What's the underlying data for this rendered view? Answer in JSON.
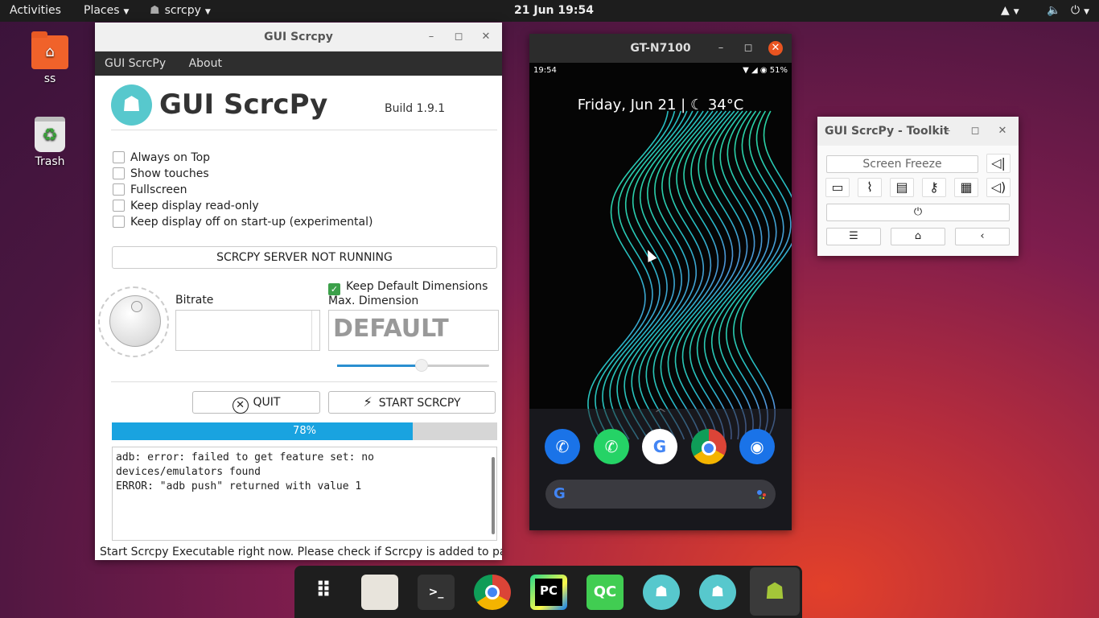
{
  "topbar": {
    "activities": "Activities",
    "places": "Places",
    "app_menu": "scrcpy",
    "clock": "21 Jun  19:54"
  },
  "desktop": {
    "home_label": "ss",
    "trash_label": "Trash"
  },
  "main_window": {
    "title": "GUI Scrcpy",
    "menu": [
      "GUI ScrcPy",
      "About"
    ],
    "app_name": "GUI ScrcPy",
    "build": "Build 1.9.1",
    "options": [
      {
        "label": "Always on Top",
        "checked": false
      },
      {
        "label": "Show touches",
        "checked": false
      },
      {
        "label": "Fullscreen",
        "checked": false
      },
      {
        "label": "Keep display read-only",
        "checked": false
      },
      {
        "label": "Keep display off on start-up (experimental)",
        "checked": false
      }
    ],
    "server_status": "SCRCPY SERVER NOT RUNNING",
    "keep_default_dimensions": {
      "label": "Keep Default Dimensions",
      "checked": true
    },
    "bitrate_label": "Bitrate",
    "max_dimension_label": "Max. Dimension",
    "max_dimension_value": "DEFAULT",
    "slider_level": 0.55,
    "quit_label": "QUIT",
    "start_label": "START SCRCPY",
    "progress": 78,
    "progress_text": "78%",
    "log": "adb: error: failed to get feature set: no\ndevices/emulators found\nERROR: \"adb push\" returned with value 1",
    "status_bar": "Start Scrcpy Executable right now. Please check if Scrcpy is added to path"
  },
  "phone_window": {
    "title": "GT-N7100",
    "status_time": "19:54",
    "battery": "51%",
    "date_widget": "Friday, Jun 21  |  ☾ 34°C",
    "dock_apps": [
      "phone-icon",
      "whatsapp-icon",
      "google-icon",
      "chrome-icon",
      "camera-icon"
    ],
    "search_g": "G"
  },
  "toolkit": {
    "title": "GUI ScrcPy - Toolkit",
    "screen_freeze": "Screen Freeze",
    "nav_menu": "☰",
    "icons": [
      "display-icon",
      "paperclip-icon",
      "card-icon",
      "key-icon",
      "grid-icon",
      "volume-down-icon",
      "volume-up-icon",
      "power-icon",
      "home-icon",
      "back-icon"
    ]
  },
  "taskbar": {
    "apps": [
      "show-apps-icon",
      "files-icon",
      "terminal-icon",
      "chrome-icon",
      "pycharm-icon",
      "qtcreator-icon",
      "guiscrcpy-icon",
      "guiscrcpy-icon-2",
      "android-icon"
    ],
    "pycharm_text": "PC",
    "qt_text": "QC"
  },
  "colors": {
    "accent": "#e95420",
    "progress": "#19a3e0",
    "checkbox_on": "#3ca04a",
    "logo": "#57c8cd"
  }
}
